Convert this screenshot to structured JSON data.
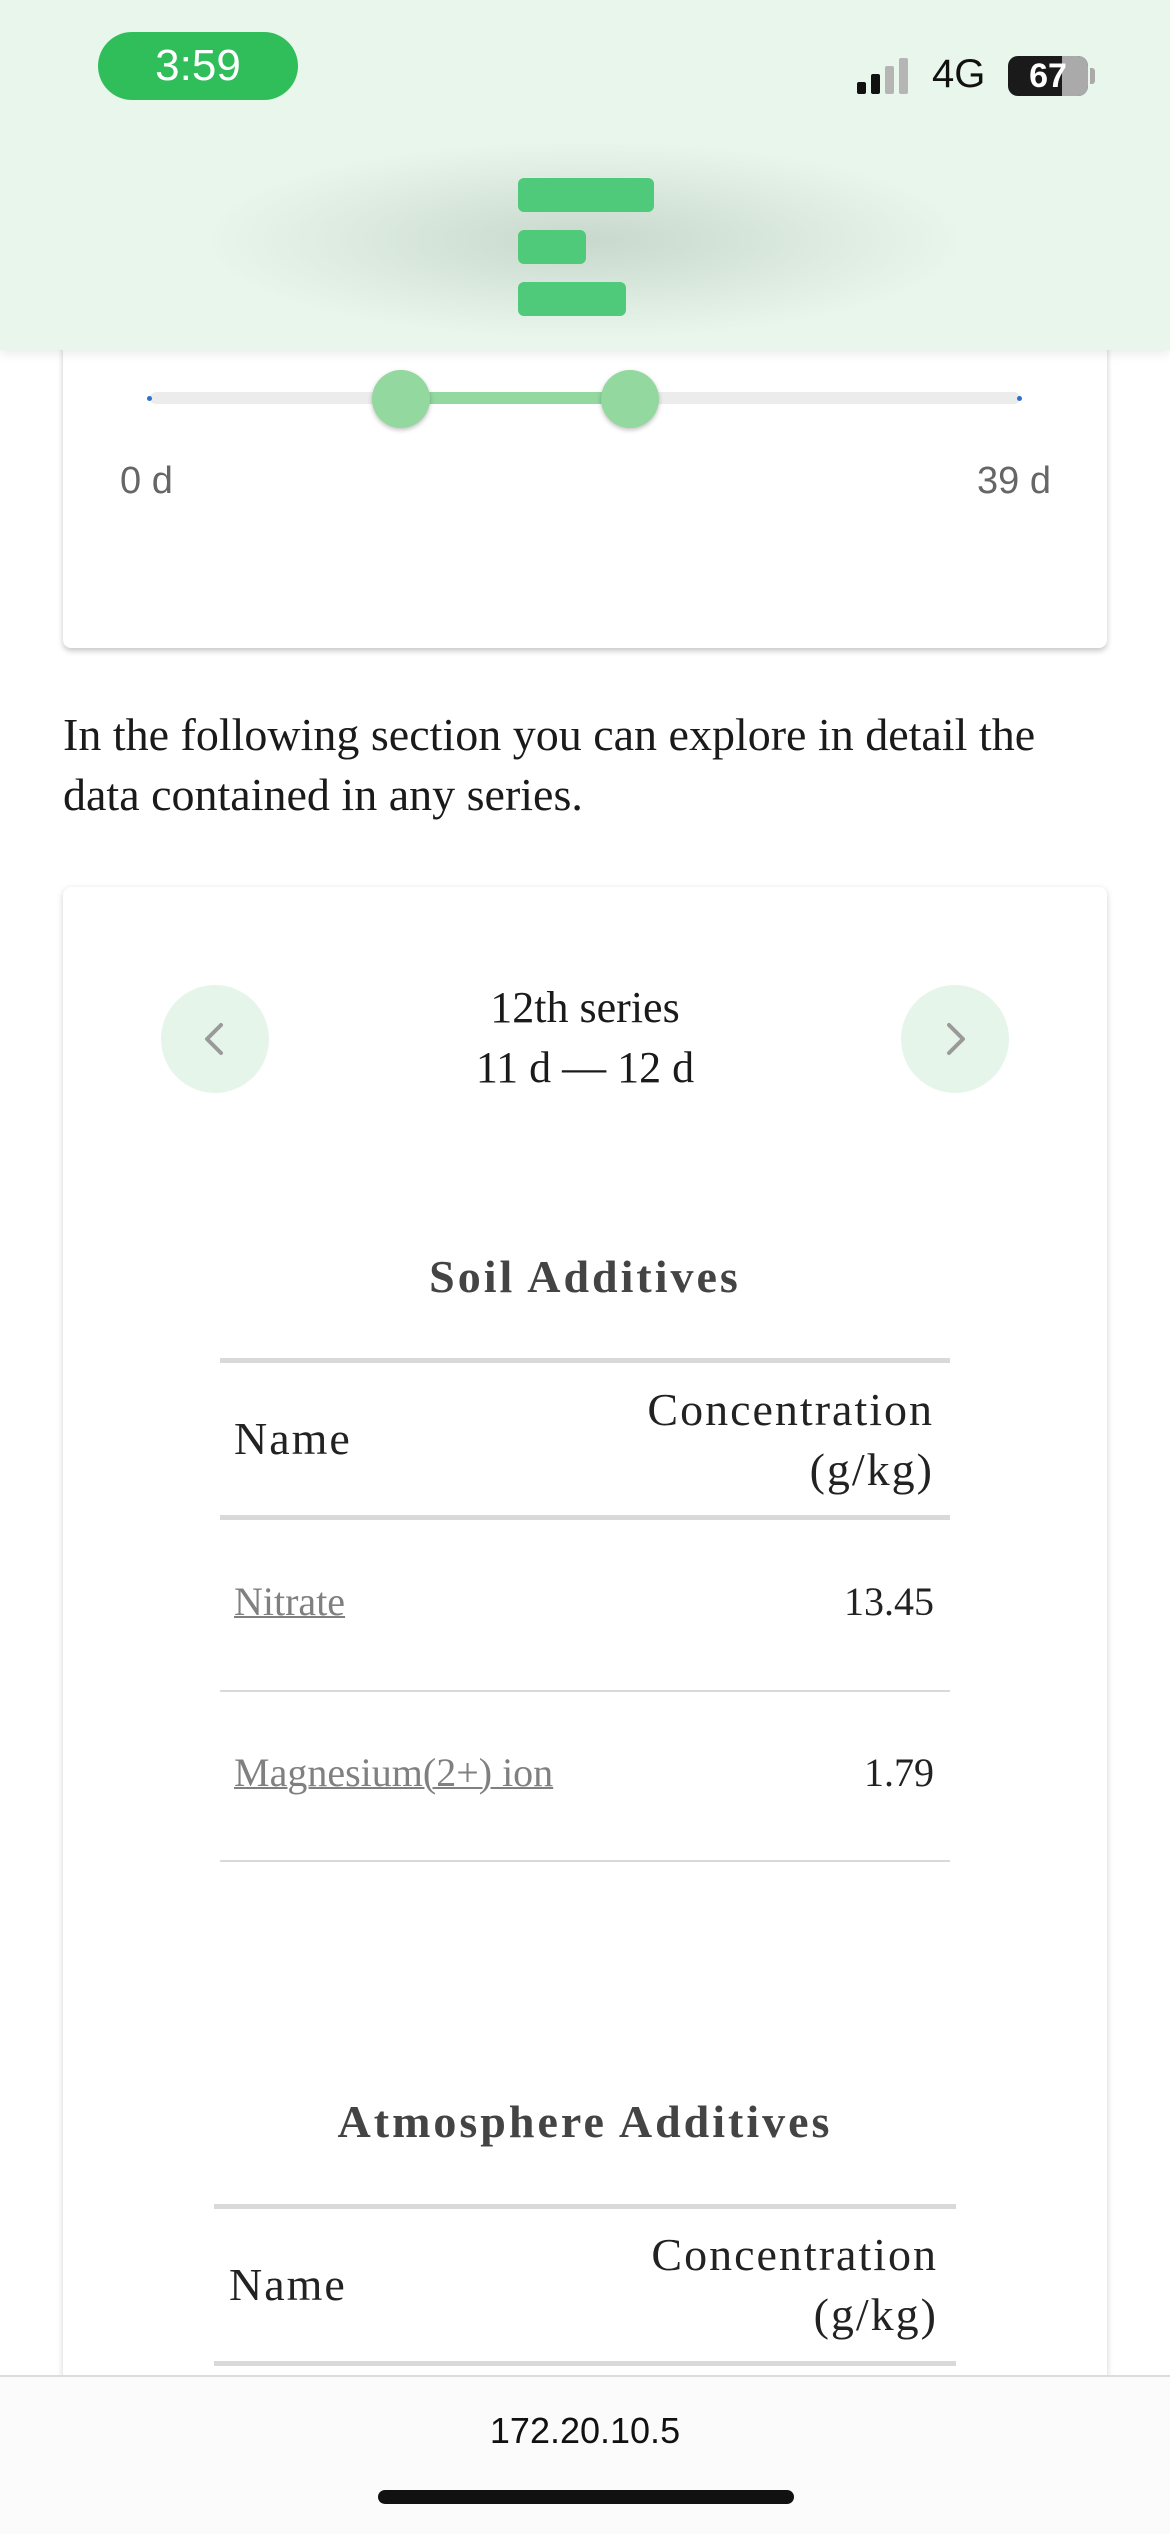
{
  "status_bar": {
    "time": "3:59",
    "network": "4G",
    "battery": "67"
  },
  "slider": {
    "min_label": "0 d",
    "max_label": "39 d"
  },
  "intro_text": "In the following section you can explore in detail the data contained in any series.",
  "series": {
    "title": "12th series",
    "range": "11 d — 12 d"
  },
  "soil": {
    "heading": "Soil Additives",
    "col_name": "Name",
    "col_conc": "Concentration (g/kg)",
    "rows": [
      {
        "name": "Nitrate",
        "value": "13.45"
      },
      {
        "name": "Magnesium(2+) ion",
        "value": "1.79"
      }
    ]
  },
  "atmosphere": {
    "heading": "Atmosphere Additives",
    "col_name": "Name",
    "col_conc": "Concentration (g/kg)"
  },
  "browser": {
    "url": "172.20.10.5"
  },
  "colors": {
    "accent": "#4fc97a",
    "slider_range": "#93d89f",
    "header_bg": "#e9f6ec"
  },
  "icons": {
    "prev": "chevron-left-icon",
    "next": "chevron-right-icon",
    "logo": "app-logo-icon"
  }
}
